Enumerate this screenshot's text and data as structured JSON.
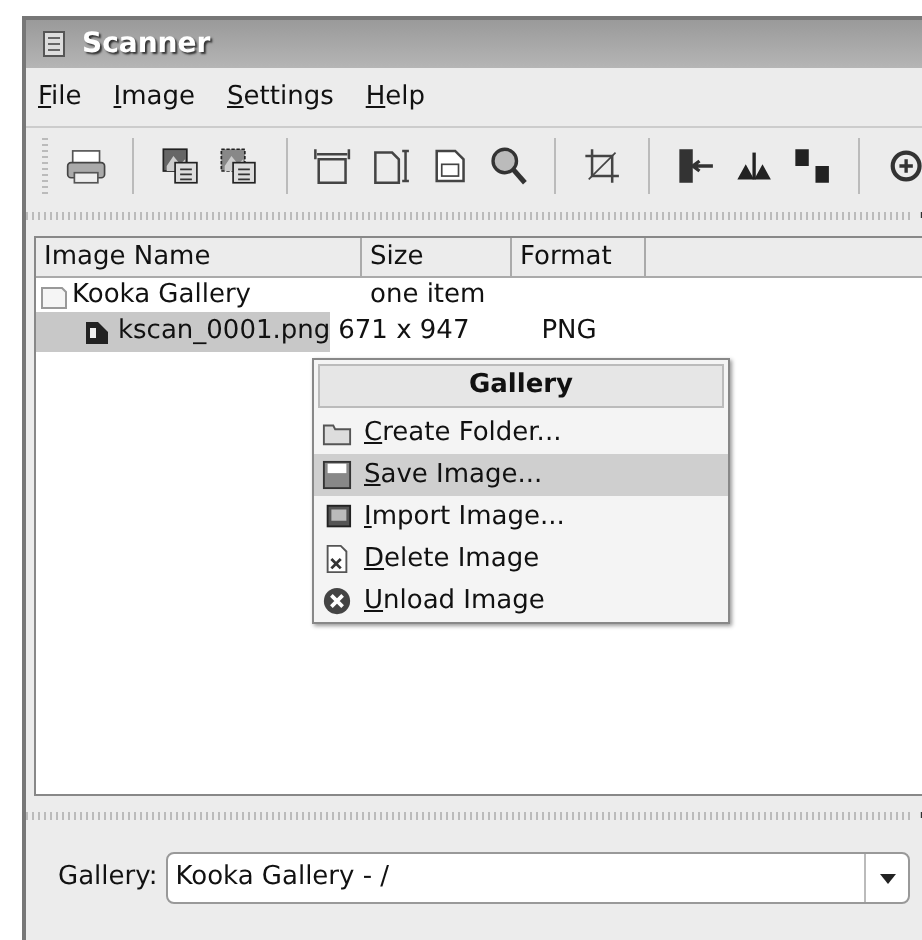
{
  "window": {
    "title": "Scanner"
  },
  "menu_bar": [
    "File",
    "Image",
    "Settings",
    "Help"
  ],
  "toolbar": {
    "buttons": [
      {
        "kind": "print"
      },
      {
        "kind": "sep"
      },
      {
        "kind": "scan"
      },
      {
        "kind": "scan-sel"
      },
      {
        "kind": "sep"
      },
      {
        "kind": "fit-width"
      },
      {
        "kind": "fit-height"
      },
      {
        "kind": "one-to-one"
      },
      {
        "kind": "zoom"
      },
      {
        "kind": "sep"
      },
      {
        "kind": "crop"
      },
      {
        "kind": "sep"
      },
      {
        "kind": "mirror-v"
      },
      {
        "kind": "mirror-h"
      },
      {
        "kind": "mirror-both"
      },
      {
        "kind": "sep"
      },
      {
        "kind": "rotate"
      }
    ]
  },
  "gallery_list": {
    "columns": [
      "Image Name",
      "Size",
      "Format"
    ],
    "rows": [
      {
        "name": "Kooka Gallery",
        "size": "one item",
        "selected": false,
        "children": [
          {
            "name": "kscan_0001.png",
            "size": "671 x 947",
            "format": "PNG",
            "selected": true
          }
        ]
      }
    ]
  },
  "context_menu": {
    "title": "Gallery",
    "items": [
      {
        "label": "Create Folder...",
        "kind": "folder",
        "selected": false
      },
      {
        "label": "Save Image...",
        "kind": "save",
        "selected": true
      },
      {
        "label": "Import Image...",
        "kind": "import",
        "selected": false
      },
      {
        "label": "Delete Image",
        "kind": "delete",
        "selected": false
      },
      {
        "label": "Unload Image",
        "kind": "unload",
        "selected": false
      }
    ]
  },
  "gallery_selector": {
    "label": "Gallery:",
    "value": "Kooka Gallery - /"
  }
}
